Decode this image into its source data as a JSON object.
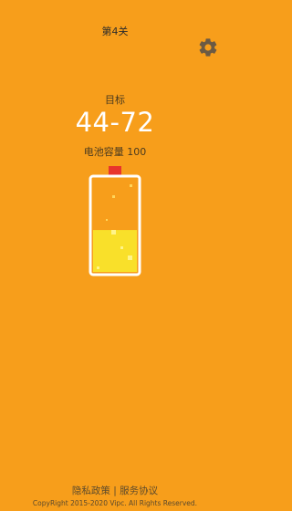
{
  "header": {
    "level_title": "第4关",
    "settings_icon": "gear-icon"
  },
  "goal": {
    "label": "目标",
    "range": "44-72",
    "capacity_text": "电池容量 100"
  },
  "battery": {
    "fill_percent": 45,
    "fill_color": "#F9E02A",
    "terminal_color": "#E8342C"
  },
  "footer": {
    "privacy_label": "隐私政策",
    "separator": "|",
    "service_label": "服务协议",
    "copyright": "CopyRight 2015-2020 Vipc. All Rights Reserved."
  },
  "colors": {
    "background": "#F79E1B",
    "text_white": "#FFFFFF"
  }
}
